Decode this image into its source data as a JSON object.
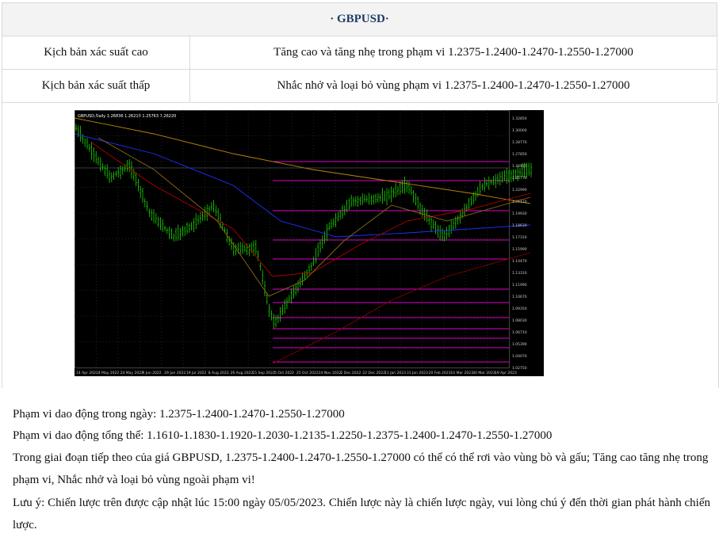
{
  "header": {
    "title": "· GBPUSD·"
  },
  "rows": [
    {
      "label": "Kịch bản xác suất cao",
      "value": "Tăng cao và tăng nhẹ trong phạm vi 1.2375-1.2400-1.2470-1.2550-1.27000"
    },
    {
      "label": "Kịch bản xác suất thấp",
      "value": "Nhắc nhở và loại bỏ vùng phạm vi 1.2375-1.2400-1.2470-1.2550-1.27000"
    }
  ],
  "chart": {
    "caption": "GBPUSD,Daily  1.26836 1.26210 1.25763 1.26220",
    "colors": {
      "background": "#000000",
      "bull": "#19d400",
      "level": "#e000c8",
      "ma1": "#b8860b",
      "ma2": "#2030ff",
      "ma3": "#b00000"
    },
    "price_labels": [
      "1.32850",
      "1.30000",
      "1.28770",
      "1.27850",
      "1.26915",
      "1.25770",
      "1.22990",
      "1.21110",
      "1.19930",
      "1.18630",
      "1.17310",
      "1.15990",
      "1.14470",
      "1.13310",
      "1.11990",
      "1.10670",
      "1.09350",
      "1.08030",
      "1.06710",
      "1.05390",
      "1.04070",
      "1.02750"
    ],
    "date_labels": [
      "14 Apr 2022",
      "4 May 2022",
      "24 May 2022",
      "9 Jun 2022",
      "29 Jun 2022",
      "19 Jul 2022",
      "8 Aug 2022",
      "26 Aug 2022",
      "15 Sep 2022",
      "5 Oct 2022",
      "25 Oct 2022",
      "14 Nov 2022",
      "2 Dec 2022",
      "22 Dec 2022",
      "11 Jan 2023",
      "31 Jan 2023",
      "20 Feb 2023",
      "10 Mar 2023",
      "30 Mar 2023",
      "19 Apr 2023"
    ]
  },
  "paragraphs": {
    "daily_range": "Phạm vi dao động trong ngày: 1.2375-1.2400-1.2470-1.2550-1.27000",
    "overall_range": "Phạm vi dao động tổng thể: 1.1610-1.1830-1.1920-1.2030-1.2135-1.2250-1.2375-1.2400-1.2470-1.2550-1.27000",
    "outlook": "Trong giai đoạn tiếp theo của giá GBPUSD, 1.2375-1.2400-1.2470-1.2550-1.27000 có thể có thể rơi vào vùng bò và gấu; Tăng cao tăng nhẹ trong phạm vi, Nhắc nhở và loại bỏ vùng ngoài phạm vi!",
    "note": "Lưu ý: Chiến lược trên được cập nhật lúc 15:00 ngày 05/05/2023. Chiến lược này là chiến lược ngày, vui lòng chú ý đến thời gian phát hành chiến lược."
  }
}
